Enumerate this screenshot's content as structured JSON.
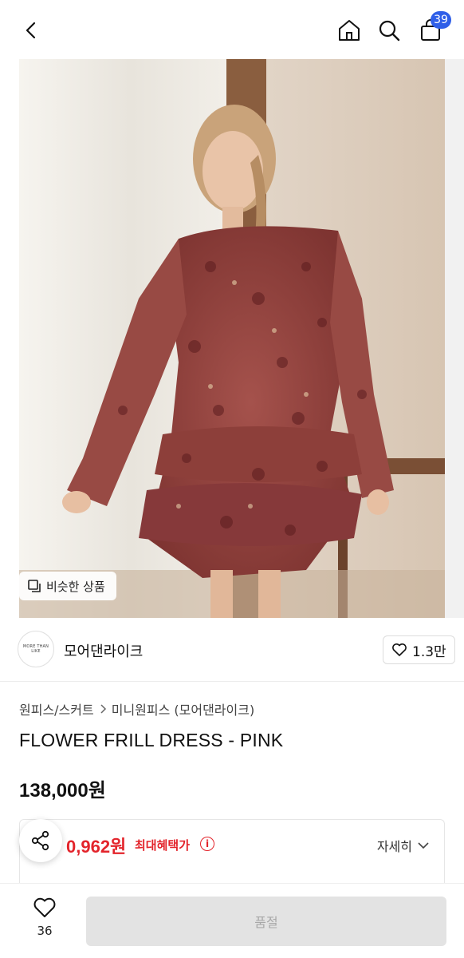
{
  "header": {
    "back_icon": "chevron-left-icon",
    "home_icon": "home-icon",
    "search_icon": "search-icon",
    "bag_icon": "shopping-bag-icon",
    "bag_count": "39"
  },
  "gallery": {
    "similar_label": "비슷한 상품"
  },
  "brand": {
    "logo_text": "MORE THAN LIKE",
    "name": "모어댄라이크",
    "likes": "1.3만"
  },
  "product": {
    "breadcrumb": [
      "원피스/스커트",
      "미니원피스 (모어댄라이크)"
    ],
    "title": "FLOWER FRILL DRESS - PINK",
    "price": "138,000원"
  },
  "benefit": {
    "price": "0,962원",
    "label": "최대혜택가",
    "info": "i",
    "detail": "자세히"
  },
  "bottom": {
    "wish_count": "36",
    "buy_label": "품절"
  },
  "colors": {
    "accent_red": "#e3242b",
    "badge_blue": "#2f5fe8"
  }
}
